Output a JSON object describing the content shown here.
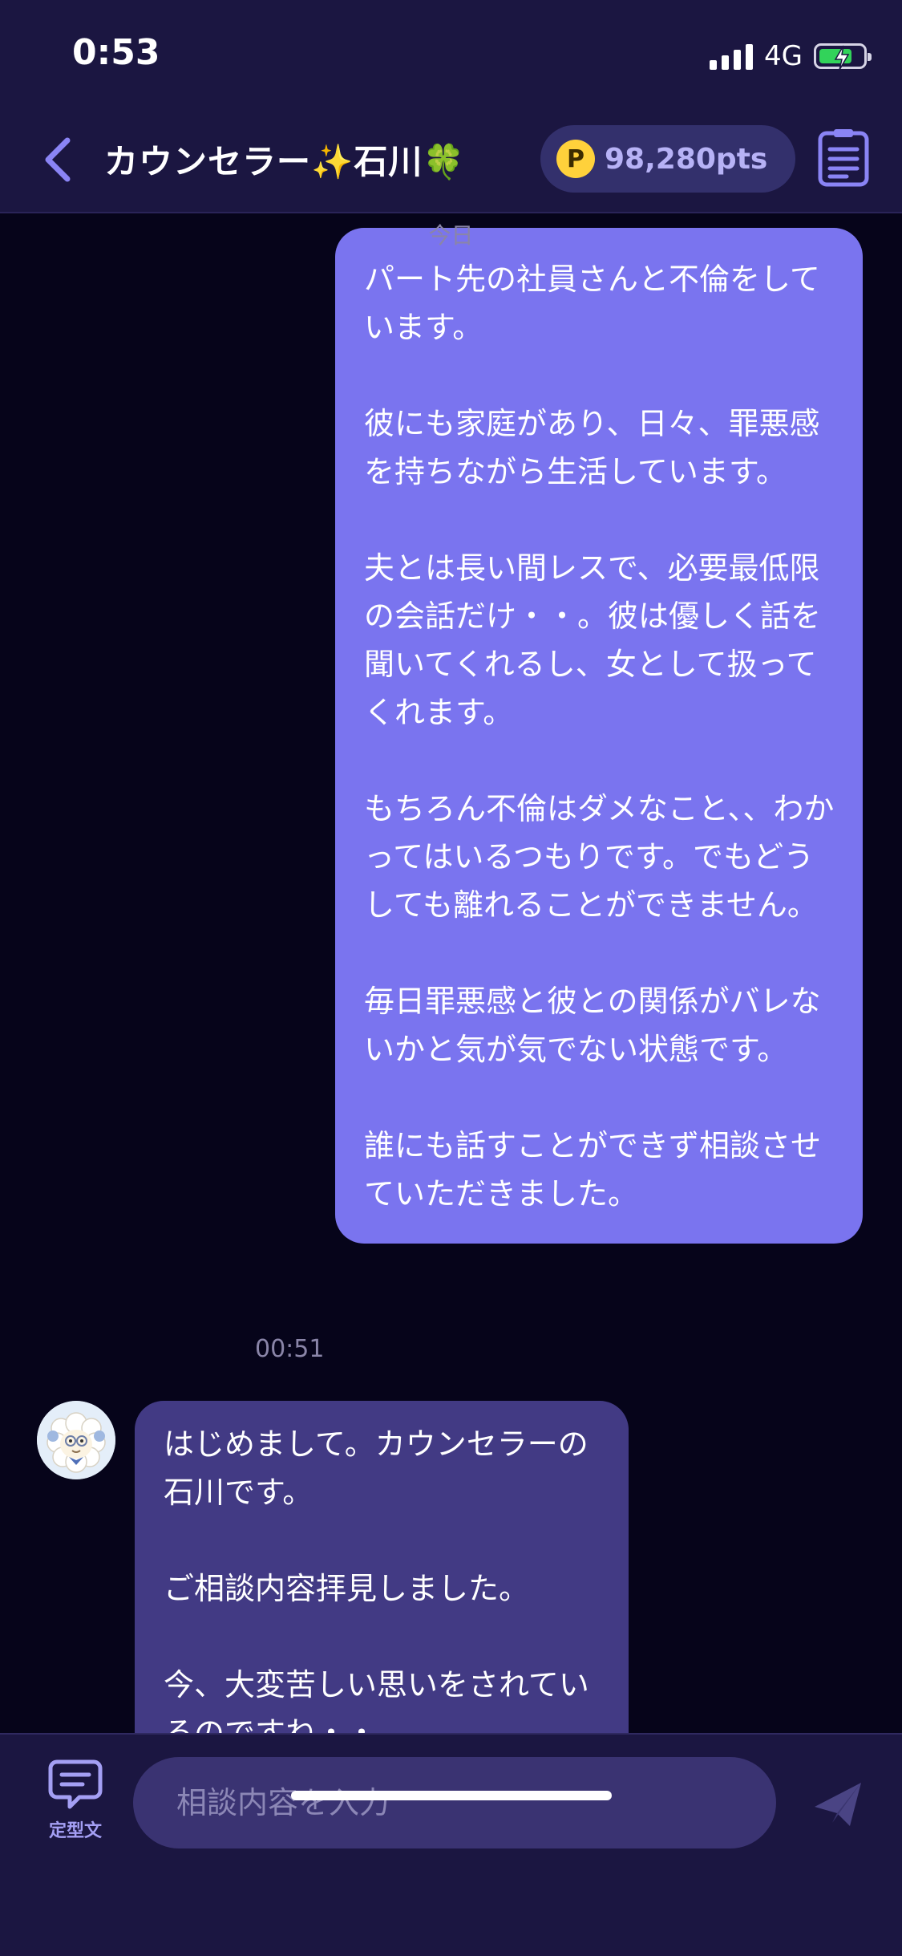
{
  "status_bar": {
    "time": "0:53",
    "network": "4G"
  },
  "header": {
    "title_prefix": "カウンセラー",
    "title_sparkle": "✨",
    "title_name": "石川",
    "title_clover": "🍀",
    "coin_letter": "P",
    "points": "98,280pts"
  },
  "chat": {
    "date_label": "今日",
    "messages": [
      {
        "side": "out",
        "text": "パート先の社員さんと不倫をしています。\n\n彼にも家庭があり、日々、罪悪感を持ちながら生活しています。\n\n夫とは長い間レスで、必要最低限の会話だけ・・。彼は優しく話を聞いてくれるし、女として扱ってくれます。\n\nもちろん不倫はダメなこと、、わかってはいるつもりです。でもどうしても離れることができません。\n\n毎日罪悪感と彼との関係がバレないかと気が気でない状態です。\n\n誰にも話すことができず相談させていただきました。",
        "time": "00:51"
      },
      {
        "side": "in",
        "text": "はじめまして。カウンセラーの石川です。\n\nご相談内容拝見しました。\n\n今、大変苦しい思いをされているのですね・・"
      }
    ]
  },
  "composer": {
    "template_label": "定型文",
    "placeholder": "相談内容を入力"
  },
  "colors": {
    "background": "#06041a",
    "header": "#1b1641",
    "outgoing_bubble": "#7a74ef",
    "incoming_bubble": "#423a84",
    "accent": "#8a84f5"
  },
  "icons": [
    "back-chevron-icon",
    "coin-icon",
    "memo-icon",
    "template-chat-icon",
    "send-icon",
    "avatar-sheep-icon"
  ]
}
